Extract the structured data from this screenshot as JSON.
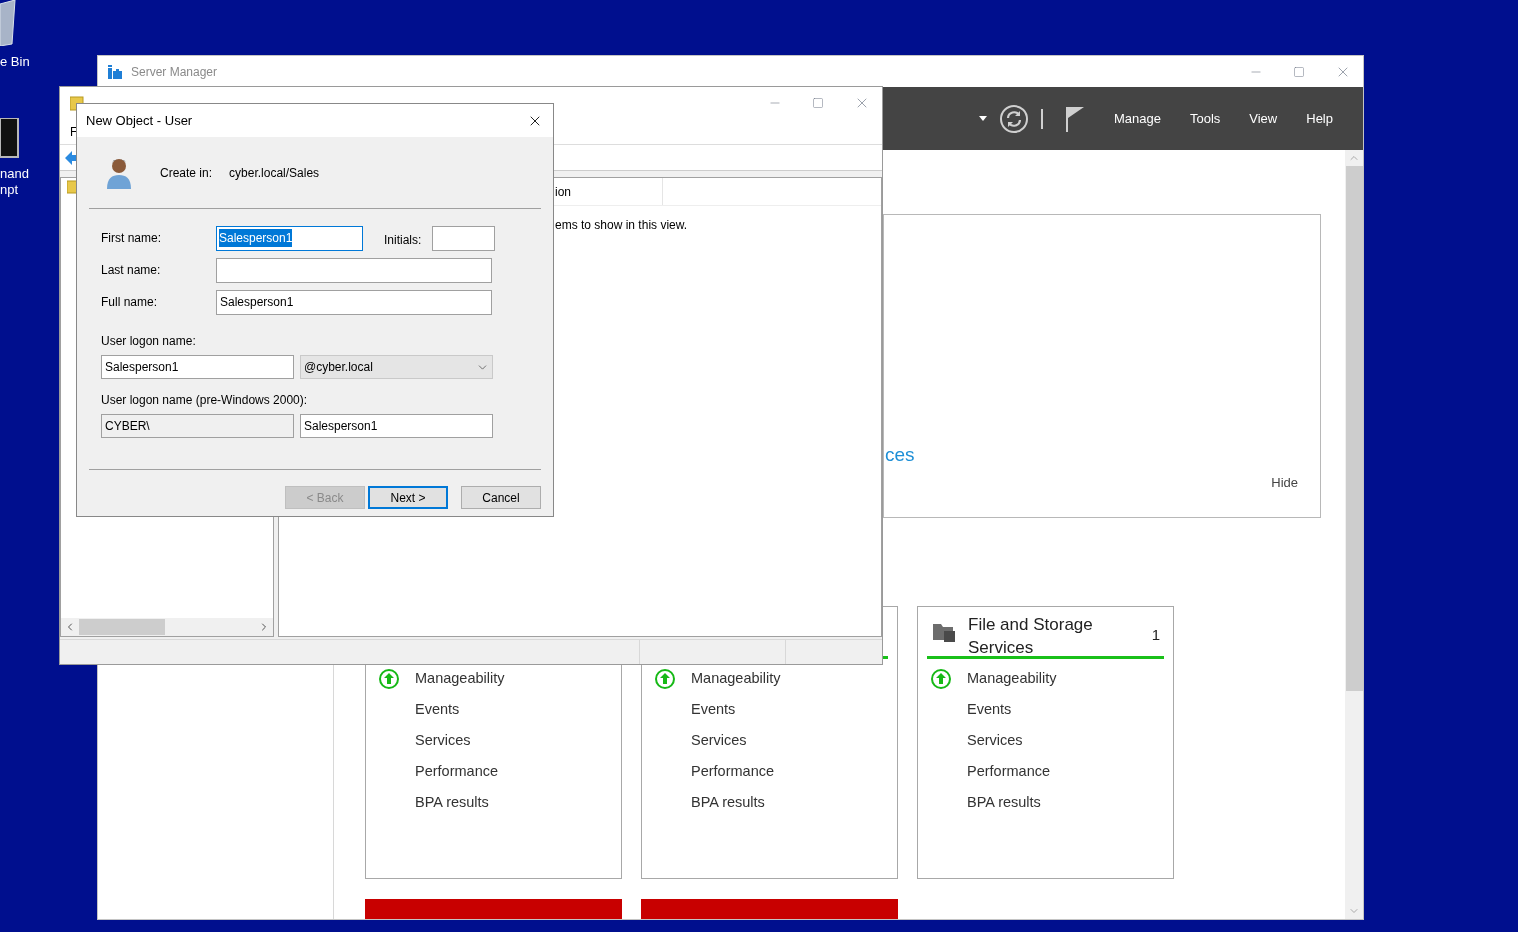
{
  "desktop_icons": [
    {
      "kind": "bin",
      "label": "e Bin"
    },
    {
      "kind": "console",
      "label": "nand\nnpt"
    }
  ],
  "server_manager": {
    "title": "Server Manager",
    "menu": [
      "Manage",
      "Tools",
      "View",
      "Help"
    ],
    "welcome": {
      "link": "ces",
      "hide": "Hide"
    },
    "tiles": [
      {
        "items": [
          {
            "label": "Manageability",
            "status_ok": true
          },
          {
            "label": "Events"
          },
          {
            "label": "Services"
          },
          {
            "label": "Performance"
          },
          {
            "label": "BPA results"
          }
        ]
      },
      {
        "items": [
          {
            "label": "Manageability",
            "status_ok": true
          },
          {
            "label": "Events"
          },
          {
            "label": "Services"
          },
          {
            "label": "Performance"
          },
          {
            "label": "BPA results"
          }
        ]
      },
      {
        "title": "File and Storage Services",
        "count": "1",
        "items": [
          {
            "label": "Manageability",
            "status_ok": true
          },
          {
            "label": "Events"
          },
          {
            "label": "Services"
          },
          {
            "label": "Performance"
          },
          {
            "label": "BPA results"
          }
        ]
      }
    ]
  },
  "aduc": {
    "menu": [
      "F"
    ],
    "column": "ion",
    "empty_message": "ems to show in this view."
  },
  "dialog": {
    "title": "New Object - User",
    "create_in_label": "Create in:",
    "create_in_value": "cyber.local/Sales",
    "first_name": {
      "label": "First name:",
      "value": "Salesperson1",
      "selected": true
    },
    "initials": {
      "label": "Initials:"
    },
    "last_name": {
      "label": "Last name:"
    },
    "full_name": {
      "label": "Full name:",
      "value": "Salesperson1"
    },
    "logon": {
      "label": "User logon name:",
      "value": "Salesperson1",
      "domain": "@cyber.local"
    },
    "pre2000": {
      "label": "User logon name (pre-Windows 2000):",
      "prefix": "CYBER\\",
      "prefix_disabled": true,
      "value": "Salesperson1"
    },
    "buttons": [
      {
        "label": "< Back",
        "disabled": true,
        "default": false
      },
      {
        "label": "Next >",
        "disabled": false,
        "default": true
      },
      {
        "label": "Cancel",
        "disabled": false,
        "default": false
      }
    ]
  }
}
